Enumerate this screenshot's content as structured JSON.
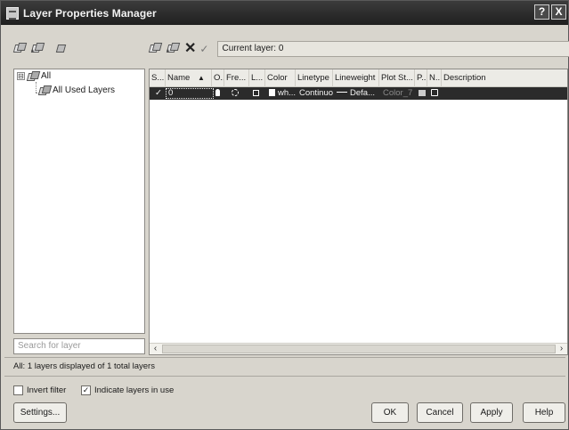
{
  "window": {
    "title": "Layer Properties Manager",
    "help_label": "?",
    "close_label": "X"
  },
  "toolbar": {
    "current_layer_label": "Current layer: 0"
  },
  "tree": {
    "items": [
      {
        "label": "All",
        "expander": "⊟"
      },
      {
        "label": "All Used Layers"
      }
    ]
  },
  "search": {
    "placeholder": "Search for layer"
  },
  "grid": {
    "columns": [
      "S...",
      "Name",
      "O...",
      "Fre...",
      "L...",
      "Color",
      "Linetype",
      "Lineweight",
      "Plot St...",
      "P...",
      "N...",
      "Description"
    ],
    "rows": [
      {
        "status": "✓",
        "name": "0",
        "color": "wh...",
        "linetype": "Continuo...",
        "lineweight": "Defa...",
        "plot_style": "Color_7",
        "description": ""
      }
    ]
  },
  "status_text": "All: 1 layers displayed of 1 total layers",
  "filters": {
    "invert_label": "Invert filter",
    "invert_checked": false,
    "indicate_label": "Indicate layers in use",
    "indicate_checked": true
  },
  "buttons": {
    "settings": "Settings...",
    "ok": "OK",
    "cancel": "Cancel",
    "apply": "Apply",
    "help": "Help"
  }
}
